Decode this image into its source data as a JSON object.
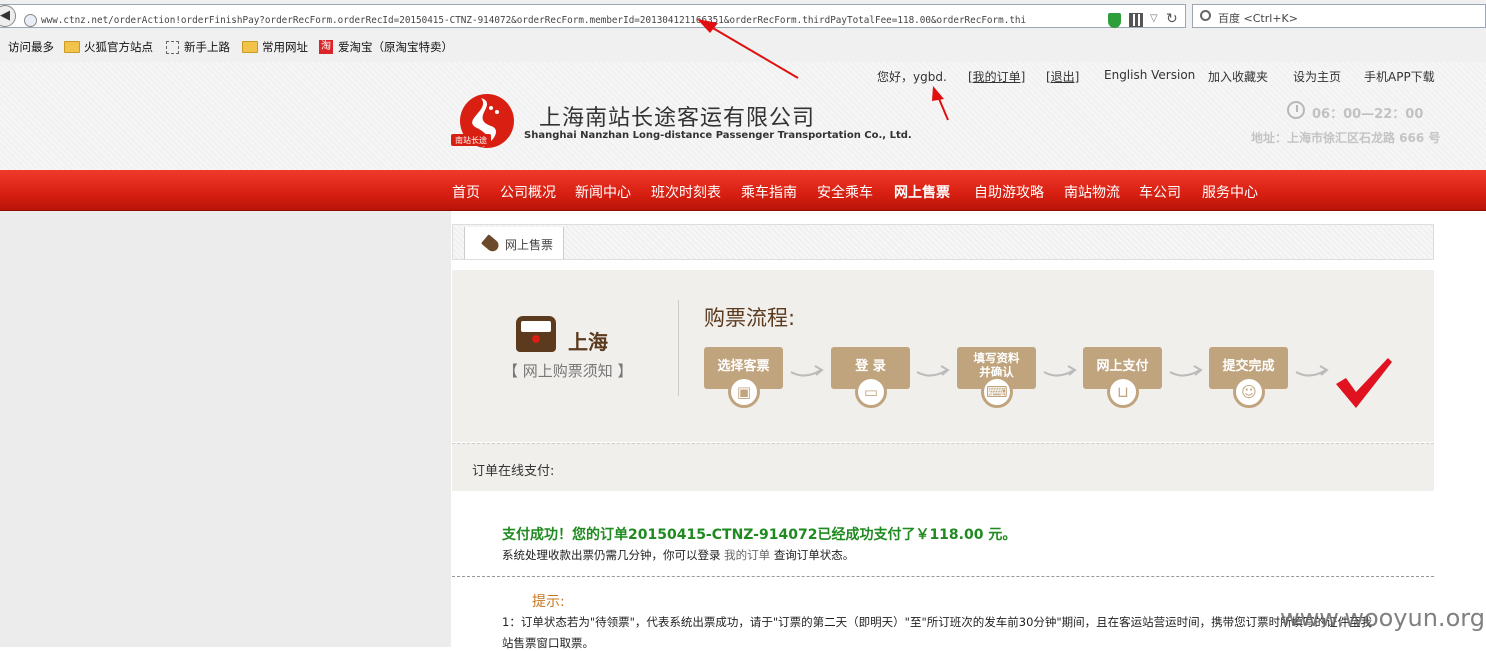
{
  "browser": {
    "url": "www.ctnz.net/orderAction!orderFinishPay?orderRecForm.orderRecId=20150415-CTNZ-914072&orderRecForm.memberId=201304121166351&orderRecForm.thirdPayTotalFee=118.00&orderRecForm.thi",
    "search_placeholder": "百度 <Ctrl+K>",
    "bookmarks": [
      {
        "label": "访问最多",
        "icon": "none"
      },
      {
        "label": "火狐官方站点",
        "icon": "folder-icon"
      },
      {
        "label": "新手上路",
        "icon": "dashed-box-icon"
      },
      {
        "label": "常用网址",
        "icon": "folder-icon"
      },
      {
        "label": "爱淘宝（原淘宝特卖）",
        "icon": "taobao-icon",
        "icon_text": "淘"
      }
    ]
  },
  "header": {
    "greeting": "您好，ygbd.",
    "links": [
      "[我的订单]",
      "[退出]",
      "English Version",
      "加入收藏夹",
      "设为主页",
      "手机APP下载"
    ],
    "company_name": "上海南站长途客运有限公司",
    "company_en": "Shanghai Nanzhan Long-distance Passenger Transportation Co., Ltd.",
    "logo_text": "南站长途",
    "hours": "06：00—22：00",
    "address": "地址：上海市徐汇区石龙路 666 号"
  },
  "nav": {
    "items": [
      "首页",
      "公司概况",
      "新闻中心",
      "班次时刻表",
      "乘车指南",
      "安全乘车",
      "网上售票",
      "自助游攻略",
      "南站物流",
      "车公司",
      "服务中心"
    ],
    "active": "网上售票"
  },
  "breadcrumb": {
    "label": "网上售票"
  },
  "flow": {
    "city": "上海",
    "notice": "【 网上购票须知 】",
    "title": "购票流程:",
    "steps": [
      {
        "label": "选择客票",
        "icon": "bus-icon"
      },
      {
        "label": "登 录",
        "icon": "monitor-icon"
      },
      {
        "label": "填写资料并确认",
        "line1": "填写资料",
        "line2": "并确认",
        "icon": "keyboard-icon"
      },
      {
        "label": "网上支付",
        "icon": "cart-icon"
      },
      {
        "label": "提交完成",
        "icon": "smile-icon"
      }
    ]
  },
  "payment": {
    "section_title": "订单在线支付:",
    "success": "支付成功！您的订单20150415-CTNZ-914072已经成功支付了￥118.00 元。",
    "sys_before": "系统处理收款出票仍需几分钟，你可以登录",
    "sys_link": "我的订单",
    "sys_after": "查询订单状态。",
    "tip_title": "提示:",
    "tip_1": "1：订单状态若为\"待领票\"，代表系统出票成功，请于\"订票的第二天（即明天）\"至\"所订班次的发车前30分钟\"期间，且在客运站营运时间，携带您订票时所填写的证件至我",
    "tip_1b": "站售票窗口取票。"
  },
  "watermark": "www.wooyun.org",
  "colors": {
    "nav_red": "#d81f12",
    "step_tan": "#c0a47e",
    "success_green": "#1f8a1f",
    "tip_orange": "#c77820",
    "brown": "#5b3a1e"
  }
}
